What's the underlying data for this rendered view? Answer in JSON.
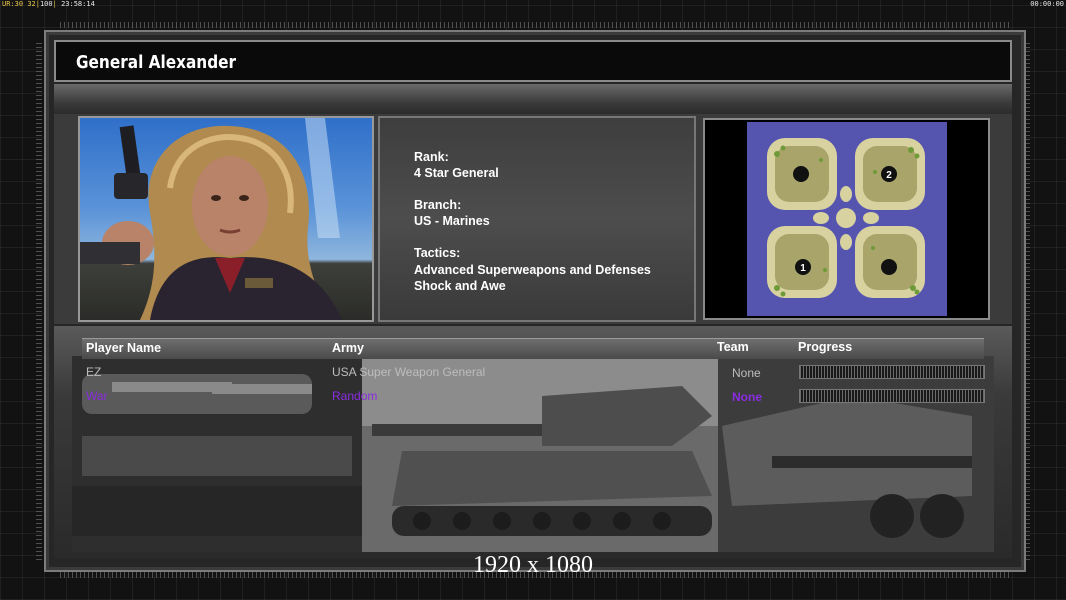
{
  "topbar": {
    "stats_prefix": "UR:",
    "stat1": "30",
    "stat2": "32",
    "stat3": "100",
    "clock": "23:58:14",
    "timer": "00:00:00"
  },
  "general": {
    "name": "General Alexander",
    "rank_label": "Rank:",
    "rank": "4 Star General",
    "branch_label": "Branch:",
    "branch": "US - Marines",
    "tactics_label": "Tactics:",
    "tactics_line1": "Advanced Superweapons and Defenses",
    "tactics_line2": "Shock and Awe"
  },
  "minimap": {
    "start_positions": [
      "1",
      "2"
    ]
  },
  "table": {
    "headers": {
      "player": "Player Name",
      "army": "Army",
      "team": "Team",
      "progress": "Progress"
    },
    "rows": [
      {
        "player": "EZ",
        "army": "USA Super Weapon General",
        "team": "None",
        "progress": 0,
        "color": "#bdbdbd"
      },
      {
        "player": "War",
        "army": "Random",
        "team": "None",
        "progress": 0,
        "color": "#8a2ce0"
      }
    ]
  },
  "resolution_label": "1920 x 1080",
  "colors": {
    "player_purple": "#8a2ce0",
    "player_gray": "#bdbdbd",
    "map_water": "#5555b0",
    "map_land": "#c9c98a"
  }
}
